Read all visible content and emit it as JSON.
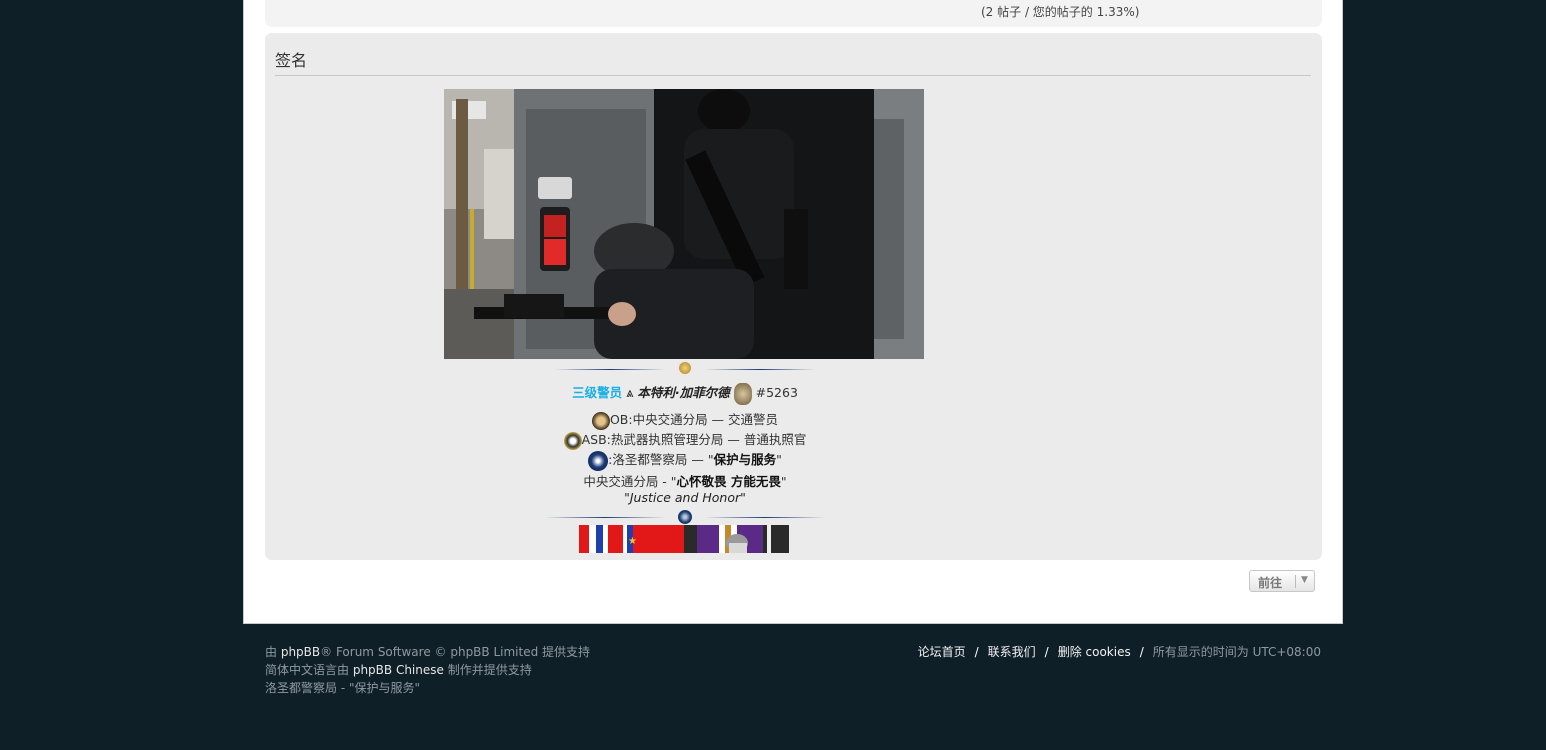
{
  "post_stats": "(2 帖子 / 您的帖子的 1.33%)",
  "signature": {
    "title": "签名",
    "rank_label": "三级警员",
    "name": "本特利·加菲尔德",
    "badge_no": "#5263",
    "line1": "OB:中央交通分局 — 交通警员",
    "line2": "ASB:热武器执照管理分局 — 普通执照官",
    "line3_prefix": ":洛圣都警察局 — \"",
    "line3_em": "保护与服务",
    "line3_suffix": "\"",
    "line4_prefix": "中央交通分局 - \"",
    "line4_em": "心怀敬畏 方能无畏",
    "line4_suffix": "\"",
    "line5": "\"Justice and Honor\""
  },
  "jumpbox": {
    "label": "前往"
  },
  "footer": {
    "credit_pre": "由 ",
    "credit_brand": "phpBB",
    "credit_post": "® Forum Software © phpBB Limited 提供支持",
    "cn_pre": "简体中文语言由 ",
    "cn_brand": "phpBB Chinese",
    "cn_post": " 制作并提供支持",
    "site_line": "洛圣都警察局 - \"保护与服务\"",
    "links": [
      "论坛首页",
      "联系我们",
      "删除 cookies"
    ],
    "timezone": "所有显示的时间为 UTC+08:00"
  },
  "colors": {
    "page_bg": "#0f1f28",
    "rank": "#1ab0e6",
    "panel": "#ebebeb"
  }
}
